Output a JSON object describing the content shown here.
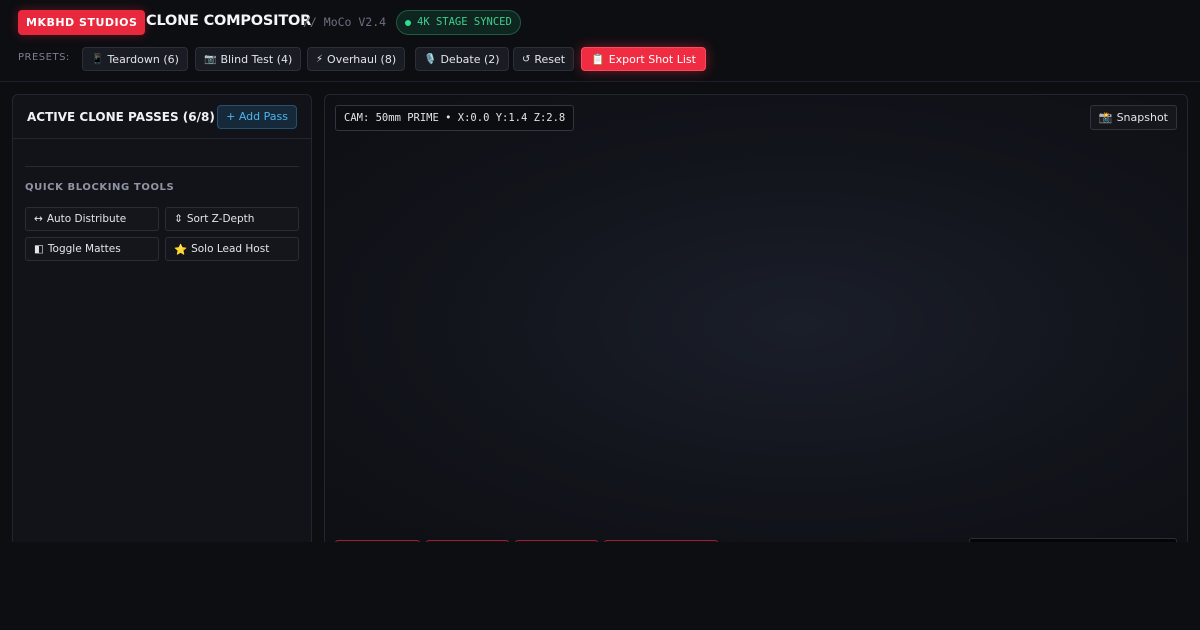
{
  "header": {
    "brand": "MKBHD STUDIOS",
    "title": "CLONE COMPOSITOR",
    "version": "// MoCo V2.4",
    "sync_status": "4K STAGE SYNCED"
  },
  "presets": {
    "label": "PRESETS:",
    "items": [
      {
        "icon": "📱",
        "label": "Teardown (6)"
      },
      {
        "icon": "📷",
        "label": "Blind Test (4)"
      },
      {
        "icon": "⚡",
        "label": "Overhaul (8)"
      },
      {
        "icon": "🎙️",
        "label": "Debate (2)"
      }
    ],
    "reset": {
      "icon": "↺",
      "label": "Reset"
    },
    "export": {
      "icon": "📋",
      "label": "Export Shot List"
    }
  },
  "left_panel": {
    "title": "ACTIVE CLONE PASSES (6/8)",
    "add_pass": "+ Add Pass",
    "quick_tools_title": "QUICK BLOCKING TOOLS",
    "tools": [
      {
        "icon": "↔",
        "label": "Auto Distribute"
      },
      {
        "icon": "⇕",
        "label": "Sort Z-Depth"
      },
      {
        "icon": "◧",
        "label": "Toggle Mattes"
      },
      {
        "icon": "⭐",
        "label": "Solo Lead Host"
      }
    ]
  },
  "viewport": {
    "camera_readout": "CAM: 50mm PRIME • X:0.0 Y:1.4 Z:2.8",
    "snapshot": {
      "icon": "📸",
      "label": "Snapshot"
    }
  },
  "colors": {
    "accent": "#f02c42",
    "sync_green": "#3ecf8e",
    "link_blue": "#4fb3ea",
    "background": "#0d0e12"
  }
}
